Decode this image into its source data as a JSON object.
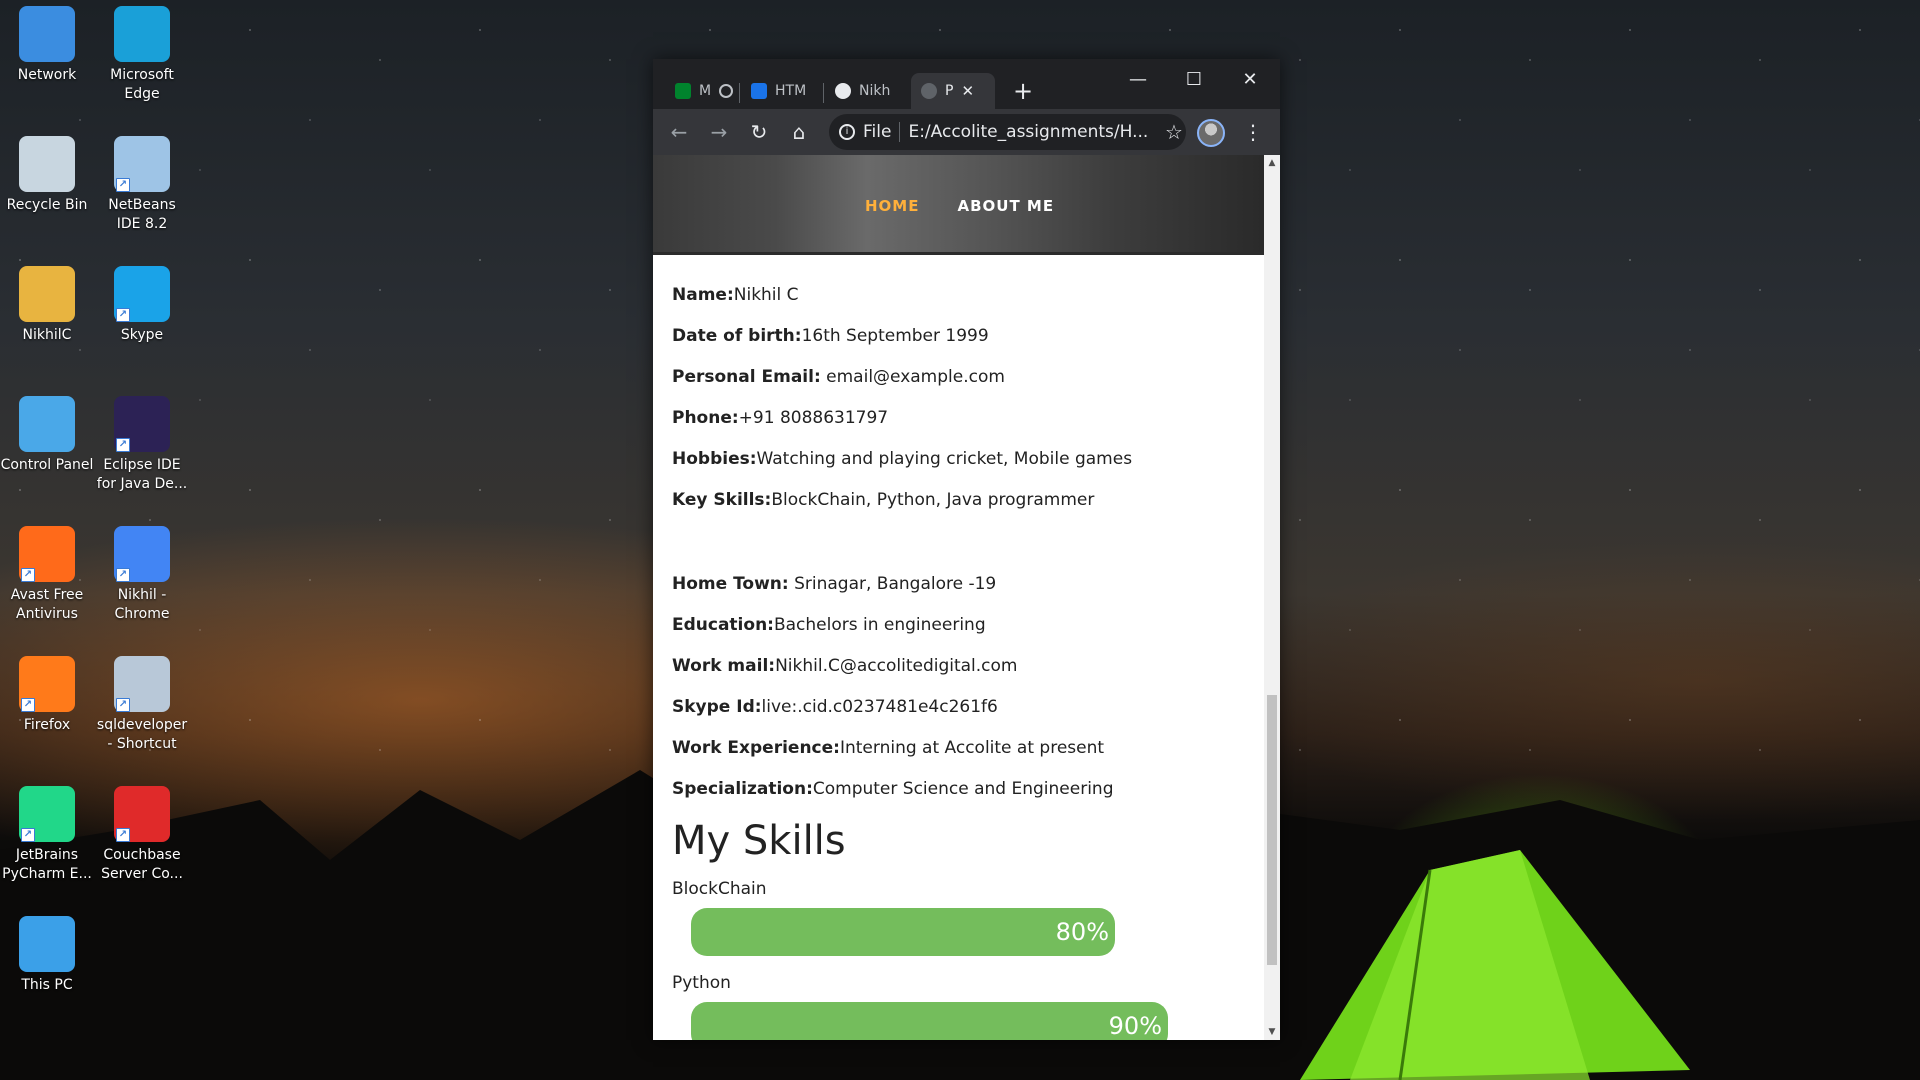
{
  "desktop": {
    "icons": [
      {
        "label": "Network",
        "color": "#3b8de0"
      },
      {
        "label": "Microsoft Edge",
        "color": "#1aa0d8"
      },
      {
        "label": "Recycle Bin",
        "color": "#c8d6e0"
      },
      {
        "label": "NetBeans IDE 8.2",
        "color": "#9ec4e6"
      },
      {
        "label": "NikhilC",
        "color": "#e8b440"
      },
      {
        "label": "Skype",
        "color": "#1aa3e8"
      },
      {
        "label": "Control Panel",
        "color": "#4aa8e8"
      },
      {
        "label": "Eclipse IDE for Java De...",
        "color": "#2c2255"
      },
      {
        "label": "Avast Free Antivirus",
        "color": "#ff6a1a"
      },
      {
        "label": "Nikhil - Chrome",
        "color": "#4285f4"
      },
      {
        "label": "Firefox",
        "color": "#ff7a1a"
      },
      {
        "label": "sqldeveloper - Shortcut",
        "color": "#b8c8d8"
      },
      {
        "label": "JetBrains PyCharm E...",
        "color": "#21d789"
      },
      {
        "label": "Couchbase Server Co...",
        "color": "#e02a2a"
      },
      {
        "label": "This PC",
        "color": "#3ba0e8"
      }
    ]
  },
  "browser": {
    "tabs": [
      {
        "title": "M",
        "icon": "meet-icon"
      },
      {
        "title": "HTM",
        "icon": "classroom-icon"
      },
      {
        "title": "Nikh",
        "icon": "github-icon"
      },
      {
        "title": "P",
        "icon": "globe-icon"
      }
    ],
    "new_tab": "+",
    "controls": {
      "minimize": "—",
      "maximize": "☐",
      "close": "✕"
    },
    "scheme": "File",
    "address": "E:/Accolite_assignments/H..."
  },
  "page": {
    "nav": {
      "home": "HOME",
      "about": "ABOUT ME"
    },
    "info": [
      {
        "k": "Name:",
        "v": "Nikhil C"
      },
      {
        "k": "Date of birth:",
        "v": "16th September 1999"
      },
      {
        "k": "Personal Email:",
        "v": " email@example.com"
      },
      {
        "k": "Phone:",
        "v": "+91 8088631797"
      },
      {
        "k": "Hobbies:",
        "v": "Watching and playing cricket, Mobile games"
      },
      {
        "k": "Key Skills:",
        "v": "BlockChain, Python, Java programmer"
      }
    ],
    "info2": [
      {
        "k": "Home Town:",
        "v": " Srinagar, Bangalore -19"
      },
      {
        "k": "Education:",
        "v": "Bachelors in engineering"
      },
      {
        "k": "Work mail:",
        "v": "Nikhil.C@accolitedigital.com"
      },
      {
        "k": "Skype Id:",
        "v": "live:.cid.c0237481e4c261f6"
      },
      {
        "k": "Work Experience:",
        "v": "Interning at Accolite at present"
      },
      {
        "k": "Specialization:",
        "v": "Computer Science and Engineering"
      }
    ],
    "skills_title": "My Skills",
    "skills": [
      {
        "name": "BlockChain",
        "percent": 80,
        "label": "80%"
      },
      {
        "name": "Python",
        "percent": 90,
        "label": "90%"
      }
    ]
  }
}
